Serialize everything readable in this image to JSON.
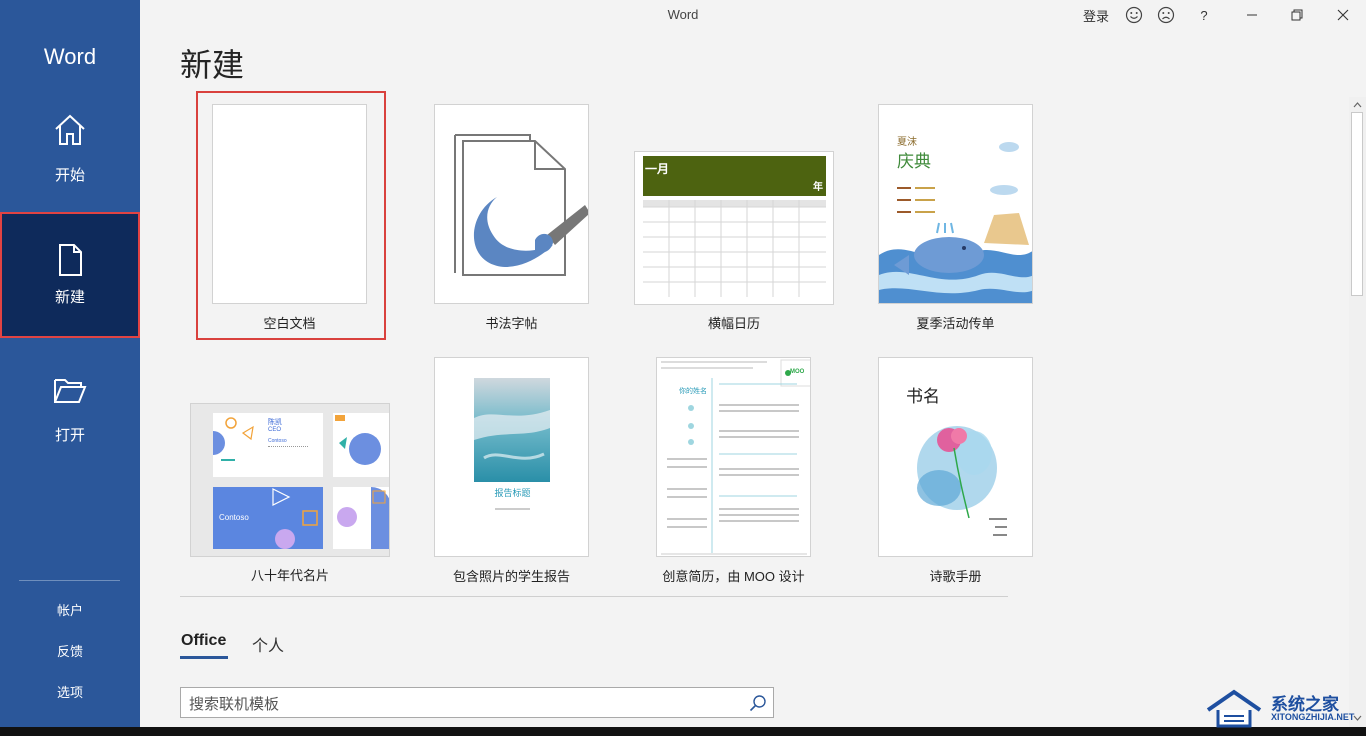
{
  "window": {
    "title": "Word",
    "signin_label": "登录",
    "smile_icon": "smile-icon",
    "frown_icon": "frown-icon",
    "help_label": "?",
    "minimize_icon": "minimize-icon",
    "restore_icon": "restore-icon",
    "close_icon": "close-icon"
  },
  "sidebar": {
    "app_name": "Word",
    "items": [
      {
        "label": "开始",
        "icon": "home-icon"
      },
      {
        "label": "新建",
        "icon": "new-document-icon",
        "selected": true
      },
      {
        "label": "打开",
        "icon": "open-folder-icon"
      }
    ],
    "bottom_links": [
      "帐户",
      "反馈",
      "选项"
    ],
    "colors": {
      "background": "#2b579a",
      "selected": "#0e2a5b"
    }
  },
  "main": {
    "title": "新建",
    "templates": [
      {
        "label": "空白文档",
        "selected": true
      },
      {
        "label": "书法字帖"
      },
      {
        "label": "横幅日历",
        "month": "一月",
        "year_label": "年"
      },
      {
        "label": "夏季活动传单",
        "heading_small": "夏沫",
        "heading": "庆典"
      },
      {
        "label": "八十年代名片",
        "name": "陈凯",
        "role": "CEO",
        "company": "Contoso",
        "brand": "Contoso"
      },
      {
        "label": "包含照片的学生报告",
        "report_title": "报告标题"
      },
      {
        "label": "创意简历，由 MOO 设计",
        "name_text": "你的姓名",
        "brand": "MOO"
      },
      {
        "label": "诗歌手册",
        "book_title": "书名"
      }
    ],
    "tabs": [
      {
        "label": "Office",
        "active": true
      },
      {
        "label": "个人"
      }
    ],
    "search_placeholder": "搜索联机模板"
  },
  "watermark": {
    "title": "系统之家",
    "subtitle": "XITONGZHIJIA.NET"
  }
}
